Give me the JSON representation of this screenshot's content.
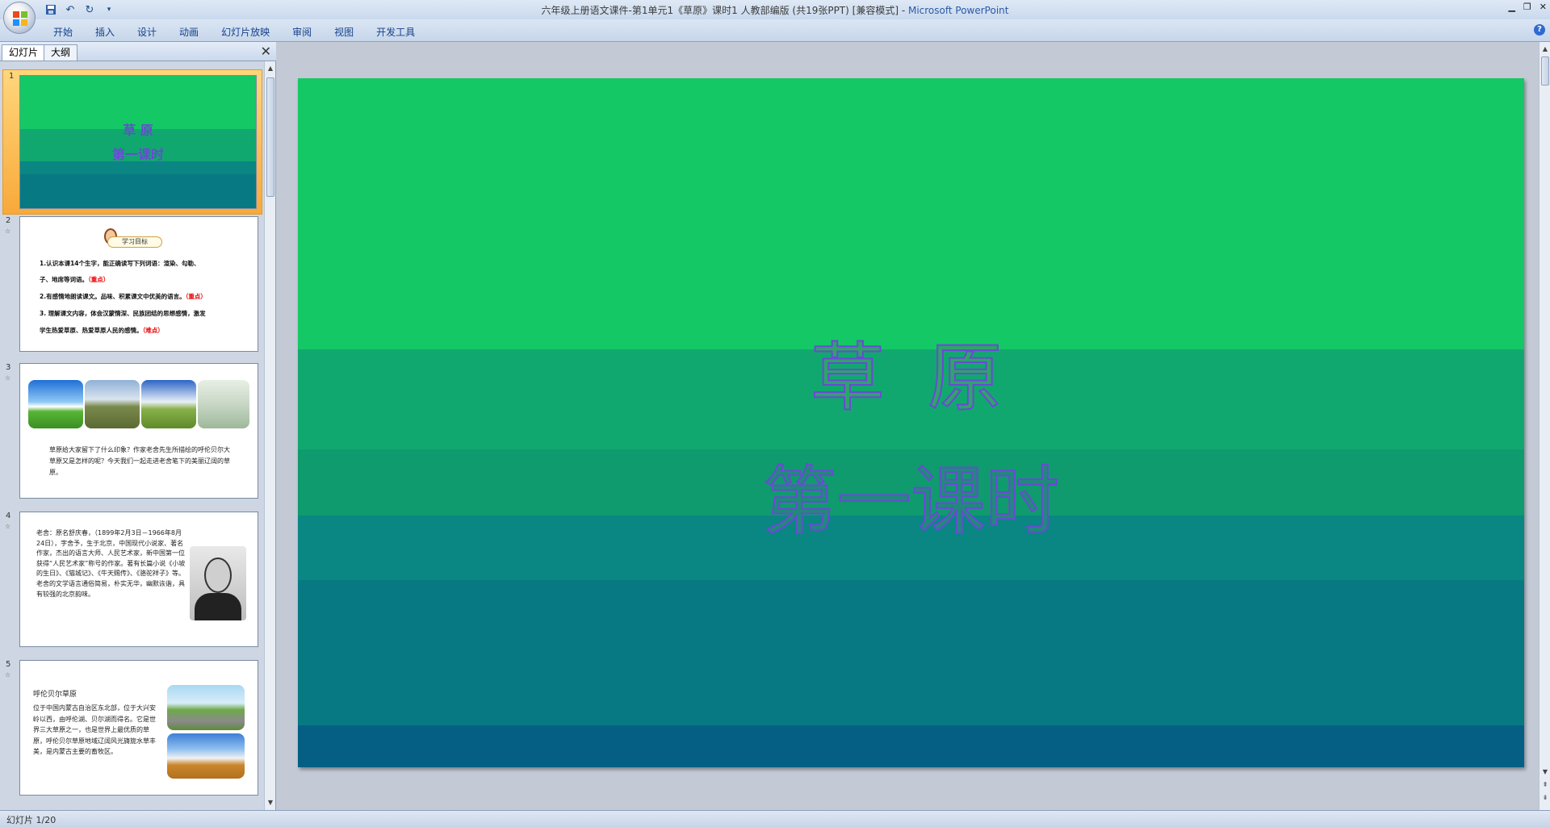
{
  "window": {
    "title": "六年级上册语文课件-第1单元1《草原》课时1 人教部编版 (共19张PPT) [兼容模式]",
    "title_separator": " - ",
    "app_name": "Microsoft PowerPoint"
  },
  "ribbon": {
    "tabs": [
      {
        "label": "开始"
      },
      {
        "label": "插入"
      },
      {
        "label": "设计"
      },
      {
        "label": "动画"
      },
      {
        "label": "幻灯片放映"
      },
      {
        "label": "审阅"
      },
      {
        "label": "视图"
      },
      {
        "label": "开发工具"
      }
    ]
  },
  "panel": {
    "tab_slides": "幻灯片",
    "tab_outline": "大纲",
    "close_glyph": "✕"
  },
  "thumbnails": {
    "s1": {
      "num": "1",
      "title": "草 原",
      "subtitle": "第一课时"
    },
    "s2": {
      "num": "2",
      "badge": "学习目标",
      "lines": [
        {
          "text": "1.认识本课14个生字，能正确读写下列词语：渲染、勾勒、",
          "note": ""
        },
        {
          "text": "子、地席等词语。",
          "note": "（重点）"
        },
        {
          "text": "2.有感情地朗读课文。品味、积累课文中优美的语言。",
          "note": "（重点）"
        },
        {
          "text": "3. 理解课文内容，体会汉蒙情深、民族团结的思想感情，激发",
          "note": ""
        },
        {
          "text": "学生热爱草原、热爱草原人民的感情。",
          "note": "（难点）"
        }
      ]
    },
    "s3": {
      "num": "3",
      "text": "草原给大家留下了什么印象？作家老舍先生所描绘的呼伦贝尔大草原又是怎样的呢？今天我们一起走进老舍笔下的美丽辽阔的草原。"
    },
    "s4": {
      "num": "4",
      "text": "老舍：原名舒庆春，（1899年2月3日－1966年8月24日），字舍予，生于北京，中国现代小说家、著名作家，杰出的语言大师、人民艺术家，新中国第一位获得“人民艺术家”称号的作家。著有长篇小说《小坡的生日》、《猫城记》、《牛天赐传》、《骆驼祥子》等。老舍的文学语言通俗简易，朴实无华，幽默诙谐，具有较强的北京韵味。"
    },
    "s5": {
      "num": "5",
      "heading": "呼伦贝尔草原",
      "text": "位于中国内蒙古自治区东北部，位于大兴安岭以西，由呼伦湖、贝尔湖而得名。它是世界三大草原之一，也是世界上最优质的草原，呼伦贝尔草原地域辽阔风光旖旎水草丰美，是内蒙古主要的畜牧区。"
    }
  },
  "slide": {
    "title": "草 原",
    "subtitle": "第一课时",
    "bands": [
      "#14c865",
      "#11a86f",
      "#0f9b6d",
      "#0a8683",
      "#077982",
      "#055f84"
    ]
  },
  "status": {
    "text": "幻灯片 1/20"
  }
}
